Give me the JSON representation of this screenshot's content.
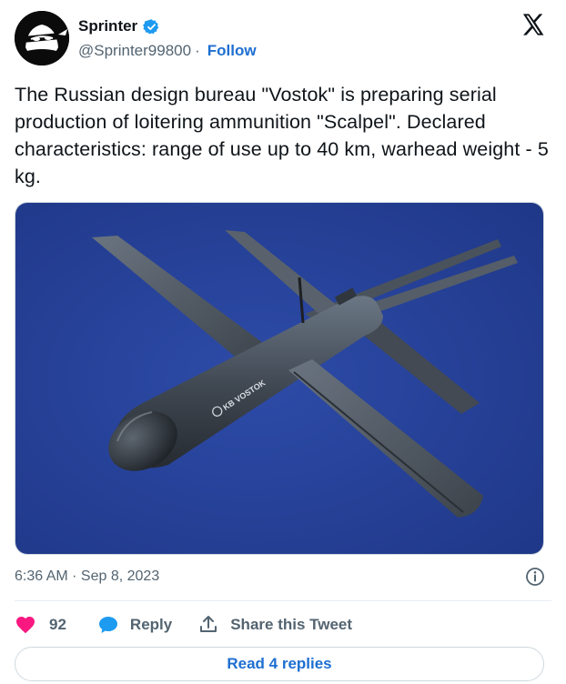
{
  "author": {
    "display_name": "Sprinter",
    "handle": "@Sprinter99800",
    "separator": "·",
    "follow_label": "Follow",
    "verified": true,
    "avatar_icon": "ninja-avatar-icon"
  },
  "brand": {
    "logo_icon": "x-logo-icon"
  },
  "tweet": {
    "text": "The Russian design bureau \"Vostok\" is preparing serial production of loitering ammunition \"Scalpel\". Declared characteristics: range of use up to 40 km, warhead weight - 5 kg.",
    "media_label": "KB VOSTOK",
    "timestamp": "6:36 AM · Sep 8, 2023"
  },
  "actions": {
    "like_count": "92",
    "reply_label": "Reply",
    "share_label": "Share this Tweet",
    "read_replies_label": "Read 4 replies"
  },
  "colors": {
    "accent": "#1d6fd1",
    "like": "#f91880",
    "verified_badge": "#1d9bf0",
    "media_background": "#26409a",
    "secondary_text": "#536471"
  }
}
